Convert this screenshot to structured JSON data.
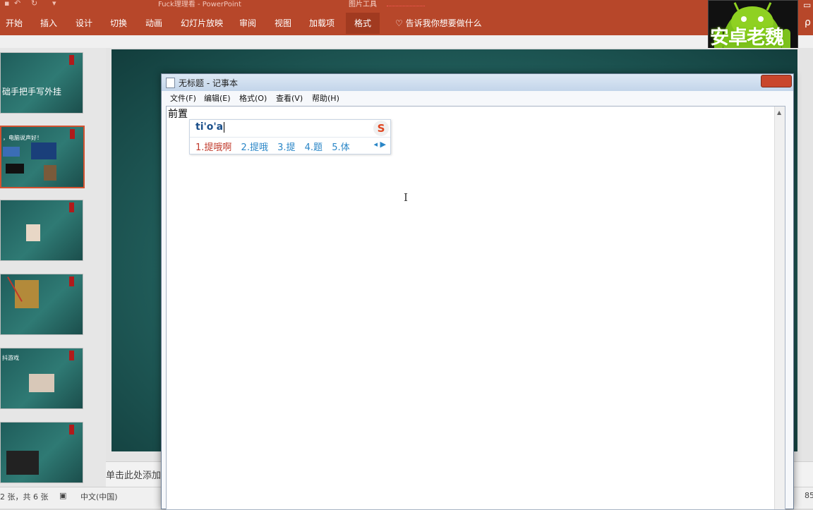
{
  "app": {
    "title": "Fuck理理看 - PowerPoint",
    "contextual_tools": "图片工具"
  },
  "ribbon": {
    "tabs": [
      "开始",
      "插入",
      "设计",
      "切换",
      "动画",
      "幻灯片放映",
      "审阅",
      "视图",
      "加载项",
      "格式"
    ],
    "tell_me": "告诉我你想要做什么"
  },
  "logo": {
    "text": "安卓老魏"
  },
  "thumbnails": {
    "slide1_title": "础手把手写外挂",
    "slide2_title": "，电脑说声好！",
    "slide5_title": "抖游戏"
  },
  "notes": {
    "placeholder": "单击此处添加"
  },
  "statusbar": {
    "slide_count": "2 张，共 6 张",
    "language": "中文(中国)",
    "zoom": "85"
  },
  "notepad": {
    "title": "无标题 - 记事本",
    "menu": [
      "文件(F)",
      "编辑(E)",
      "格式(O)",
      "查看(V)",
      "帮助(H)"
    ],
    "content": "前置"
  },
  "ime": {
    "composition": "ti'o'a",
    "candidates": [
      "1.提哦啊",
      "2.提哦",
      "3.提",
      "4.题",
      "5.体"
    ],
    "logo": "S"
  }
}
